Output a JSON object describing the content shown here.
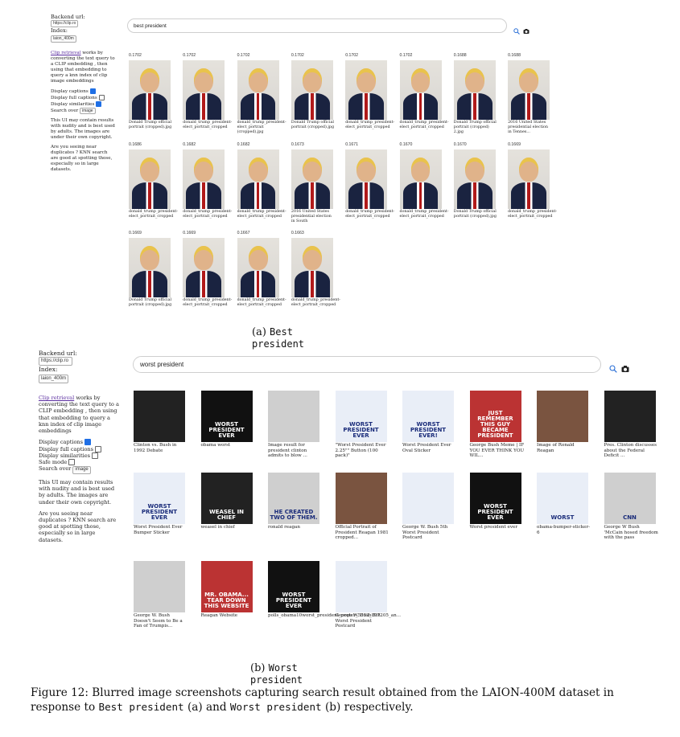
{
  "panel_a": {
    "sidebar": {
      "backend_label": "Backend url:",
      "backend_value": "https://clip.ro",
      "index_label": "Index:",
      "index_value": "laion_400m",
      "intro_link": "Clip retrieval",
      "intro_text": "works by converting the text query to a CLIP embedding , then using that embedding to query a knn index of clip image embeddings",
      "display_captions": "Display captions",
      "display_full_captions": "Display full captions",
      "display_similarities": "Display similarities",
      "search_over": "Search over",
      "search_over_value": "image",
      "warning": "This UI may contain results with nudity and is best used by adults. The images are under their own copyright.",
      "duplicates": "Are you seeing near duplicates ? KNN search are good at spotting those, especially so in large datasets."
    },
    "query": "best president",
    "rows": [
      [
        {
          "score": "0.1702",
          "caption": "Donald Trump official portrait (cropped).jpg",
          "style": "trump"
        },
        {
          "score": "0.1702",
          "caption": "donald_trump_president-elect_portrait_cropped",
          "style": "trump"
        },
        {
          "score": "0.1702",
          "caption": "donald_trump_president-elect_portrait (cropped).jpg",
          "style": "trump"
        },
        {
          "score": "0.1702",
          "caption": "Donald Trump official portrait (cropped).jpg",
          "style": "trump"
        },
        {
          "score": "0.1702",
          "caption": "donald_trump_president-elect_portrait_cropped",
          "style": "trump"
        },
        {
          "score": "0.1702",
          "caption": "donald_trump_president-elect_portrait_cropped",
          "style": "trump"
        },
        {
          "score": "0.1688",
          "caption": "Donald Trump official portrait (cropped) 2.jpg",
          "style": "trump"
        },
        {
          "score": "0.1688",
          "caption": "2016 United States presidential election in Tennes...",
          "style": "trump"
        }
      ],
      [
        {
          "score": "0.1686",
          "caption": "donald_trump_president-elect_portrait_cropped",
          "style": "trump"
        },
        {
          "score": "0.1682",
          "caption": "donald_trump_president-elect_portrait_cropped",
          "style": "trump"
        },
        {
          "score": "0.1682",
          "caption": "donald_trump_president-elect_portrait_cropped",
          "style": "trump"
        },
        {
          "score": "0.1673",
          "caption": "2016 United States presidential election in South",
          "style": "trump"
        },
        {
          "score": "0.1671",
          "caption": "donald_trump_president-elect_portrait_cropped",
          "style": "trump"
        },
        {
          "score": "0.1670",
          "caption": "donald_trump_president-elect_portrait_cropped",
          "style": "trump"
        },
        {
          "score": "0.1670",
          "caption": "Donald Trump official portrait (cropped).jpg",
          "style": "trump"
        },
        {
          "score": "0.1669",
          "caption": "donald_trump_president-elect_portrait_cropped",
          "style": "trump"
        }
      ],
      [
        {
          "score": "0.1669",
          "caption": "Donald Trump official portrait (cropped).jpg",
          "style": "trump"
        },
        {
          "score": "0.1669",
          "caption": "donald_trump_president-elect_portrait_cropped",
          "style": "trump"
        },
        {
          "score": "0.1667",
          "caption": "donald_trump_president-elect_portrait_cropped",
          "style": "trump"
        },
        {
          "score": "0.1663",
          "caption": "donald_trump_president-elect_portrait_cropped",
          "style": "trump"
        }
      ]
    ],
    "subcaption_label": "(a)",
    "subcaption_mono": "Best president"
  },
  "panel_b": {
    "sidebar": {
      "backend_label": "Backend url:",
      "backend_value": "https://clip.ro",
      "index_label": "Index:",
      "index_value": "laion_400m",
      "intro_link": "Clip retrieval",
      "intro_text": "works by converting the text query to a CLIP embedding , then using that embedding to query a knn index of clip image embeddings",
      "display_captions": "Display captions",
      "display_full_captions": "Display full captions",
      "display_similarities": "Display similarities",
      "safe_mode": "Safe mode",
      "search_over": "Search over",
      "search_over_value": "image",
      "warning": "This UI may contain results with nudity and is best used by adults. The images are under their own copyright.",
      "duplicates": "Are you seeing near duplicates ? KNN search are good at spotting those, especially so in large datasets."
    },
    "query": "worst president",
    "rows": [
      [
        {
          "caption": "Clinton vs. Bush in 1992 Debate",
          "style": "dark",
          "overlay": ""
        },
        {
          "caption": "obama worst",
          "style": "black",
          "overlay": "WORST PRESIDENT EVER"
        },
        {
          "caption": "Image result for president clinton admits to blow ...",
          "style": "gray",
          "overlay": ""
        },
        {
          "caption": "\"Worst President Ever 2.25\"\" Button (100 pack)\"",
          "style": "blue",
          "overlay": "WORST PRESIDENT EVER"
        },
        {
          "caption": "Worst President Ever Oval Sticker",
          "style": "blue",
          "overlay": "WORST PRESIDENT EVER!"
        },
        {
          "caption": "George Bush Meme | IF YOU EVER THINK YOU WIL...",
          "style": "red",
          "overlay": "JUST REMEMBER THIS GUY BECAME PRESIDENT"
        },
        {
          "caption": "Image of Ronald Reagan",
          "style": "warm",
          "overlay": ""
        },
        {
          "caption": "Pres. Clinton discusses about the Federal Deficit ...",
          "style": "dark",
          "overlay": ""
        }
      ],
      [
        {
          "caption": "Worst President Ever Bumper Sticker",
          "style": "blue",
          "overlay": "WORST PRESIDENT EVER"
        },
        {
          "caption": "weasel in chief",
          "style": "dark",
          "overlay": "WEASEL IN CHIEF"
        },
        {
          "caption": "ronald reagan",
          "style": "gray",
          "overlay": "HE CREATED TWO OF THEM."
        },
        {
          "caption": "Official Portrait of President Reagan 1981 cropped...",
          "style": "warm",
          "overlay": ""
        },
        {
          "caption": "George W. Bush 5th Worst President Postcard",
          "style": "blue",
          "overlay": ""
        },
        {
          "caption": "Worst president ever",
          "style": "black",
          "overlay": "WORST PRESIDENT EVER"
        },
        {
          "caption": "obama-bumper-sticker-6",
          "style": "blue",
          "overlay": "WORST"
        },
        {
          "caption": "George W Bush 'McCain hosed freedom with the pass",
          "style": "gray",
          "overlay": "CNN"
        }
      ],
      [
        {
          "caption": "George W. Bush Doesn't Seem to Be a Fan of Trumpis...",
          "style": "gray",
          "overlay": ""
        },
        {
          "caption": "Reagan Website",
          "style": "red",
          "overlay": "MR. OBAMA... TEAR DOWN THIS WEBSITE"
        },
        {
          "caption": "polls_obama10worst_president_poster_5352_807205_an...",
          "style": "black",
          "overlay": "WORST PRESIDENT EVER"
        },
        {
          "caption": "George W. Bush 5th Worst President Postcard",
          "style": "blue",
          "overlay": ""
        }
      ]
    ],
    "subcaption_label": "(b)",
    "subcaption_mono": "Worst president"
  },
  "figure_caption": {
    "prefix": "Figure 12: Blurred image screenshots capturing search result obtained from the LAION-400M dataset in response to ",
    "q1": "Best president",
    "mid": " (a) and ",
    "q2": "Worst president",
    "suffix": " (b) respectively."
  }
}
